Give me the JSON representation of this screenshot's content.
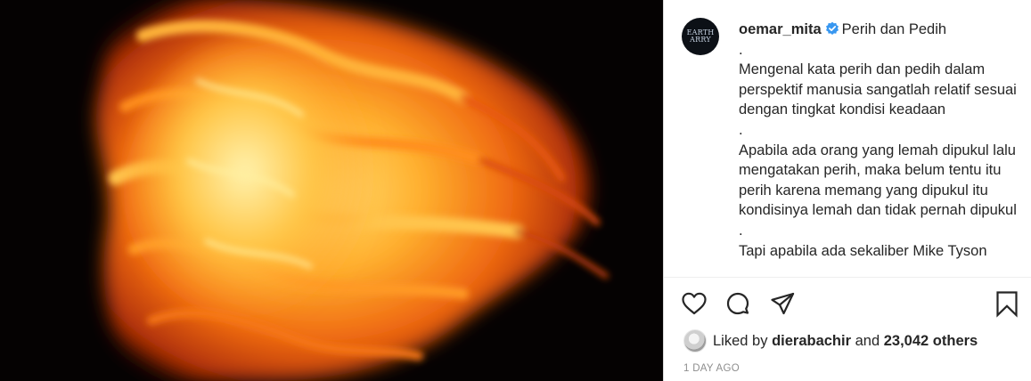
{
  "post": {
    "username": "oemar_mita",
    "avatar_logo_text": "EARTH ARRY",
    "caption_title": "Perih dan Pedih",
    "caption_body": ".\nMengenal kata perih dan pedih dalam perspektif manusia sangatlah relatif sesuai dengan tingkat kondisi keadaan\n.\nApabila ada orang yang lemah dipukul lalu mengatakan perih, maka belum tentu itu perih karena memang yang dipukul itu kondisinya lemah dan tidak pernah dipukul\n.\nTapi apabila ada sekaliber Mike Tyson",
    "verified_icon": "verified-badge-icon"
  },
  "actions": {
    "like_icon": "heart-icon",
    "comment_icon": "comment-icon",
    "share_icon": "paper-plane-icon",
    "save_icon": "bookmark-icon"
  },
  "likes": {
    "prefix": "Liked by",
    "liker": "dierabachir",
    "conjunction": "and",
    "others": "23,042 others"
  },
  "timestamp": "1 DAY AGO",
  "colors": {
    "verified": "#3897f0",
    "text": "#262626",
    "muted": "#8e8e8e",
    "border": "#dbdbdb"
  }
}
